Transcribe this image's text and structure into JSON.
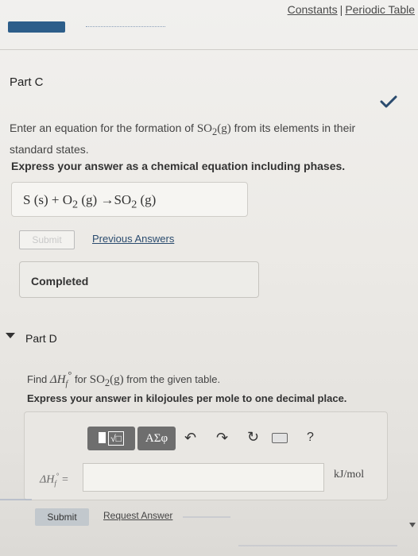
{
  "header": {
    "constants_label": "Constants",
    "separator": "|",
    "periodic_table_label": "Periodic Table"
  },
  "part_c": {
    "title": "Part C",
    "question_prefix": "Enter an equation for the formation of ",
    "question_formula_base": "SO",
    "question_formula_sub": "2",
    "question_formula_phase": "(g)",
    "question_suffix": " from its elements in their standard states.",
    "instruction": "Express your answer as a chemical equation including phases.",
    "answer": {
      "s": "S",
      "s_phase": "(s)",
      "plus": "+",
      "o": "O",
      "o_sub": "2",
      "o_phase": "(g)",
      "arrow": "→",
      "p": "SO",
      "p_sub": "2",
      "p_phase": "(g)"
    },
    "submit_label": "Submit",
    "previous_answers_label": "Previous Answers",
    "status": "Completed"
  },
  "part_d": {
    "title": "Part D",
    "question_prefix": "Find ",
    "dh_symbol": "ΔH",
    "dh_sub": "f",
    "dh_sup": "°",
    "question_for": " for ",
    "formula_base": "SO",
    "formula_sub": "2",
    "formula_phase": "(g)",
    "question_suffix": " from the given table.",
    "instruction": "Express your answer in kilojoules per mole to one decimal place.",
    "toolbar": {
      "templates_label": "√□",
      "greek_label": "ΑΣφ",
      "undo_icon": "↶",
      "redo_icon": "↷",
      "reset_icon": "↻",
      "help_label": "?"
    },
    "input_label_eq": "=",
    "input_value": "",
    "unit": "kJ/mol",
    "submit_label": "Submit",
    "request_answer_label": "Request Answer"
  },
  "colors": {
    "accent_dark": "#2d5e8a",
    "link": "#2a4b6e",
    "check": "#2a4b6e"
  }
}
